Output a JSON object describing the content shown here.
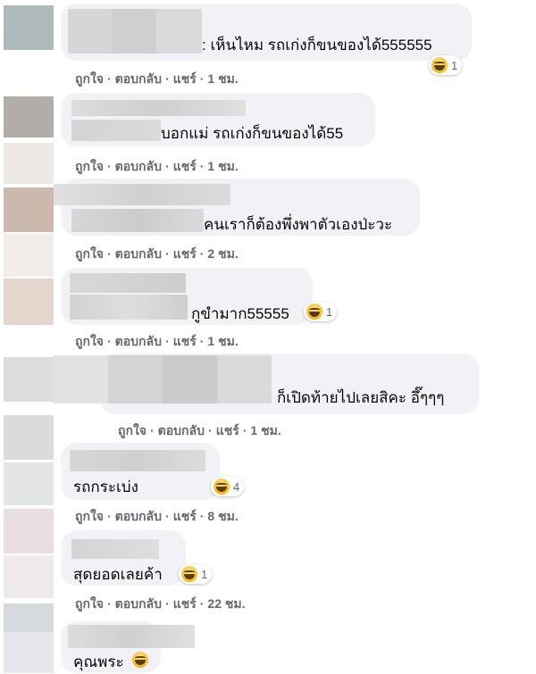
{
  "comments": [
    {
      "text": ": เห็นไหม รถเก่งก็ขนของได้555555",
      "reaction_count": "1",
      "time": "1 ชม."
    },
    {
      "text": "บอกแม่ รถเก่งก็ขนของได้55",
      "time": "1 ชม."
    },
    {
      "text": "คนเราก็ต้องพึ่งพาตัวเองป่ะวะ",
      "time": "2 ชม."
    },
    {
      "text": "กูขำมาก55555",
      "reaction_count": "1",
      "time": "1 ชม."
    },
    {
      "text": "ก็เปิดท้ายไปเลยสิคะ อึ๊ๆๆๆ",
      "time": "1 ชม."
    },
    {
      "text": "รถกระเบ่ง",
      "reaction_count": "4",
      "time": "8 ชม."
    },
    {
      "text": "สุดยอดเลยค้า",
      "reaction_count": "1",
      "time": "22 ชม."
    },
    {
      "text": "คุณพระ"
    }
  ],
  "actions": {
    "like": "ถูกใจ",
    "reply": "ตอบกลับ",
    "share": "แชร์",
    "dot": "·"
  },
  "colors": {
    "bubble": "#f0f2f5",
    "meta": "#65676b",
    "text": "#050505",
    "haha": "#f7b928"
  }
}
